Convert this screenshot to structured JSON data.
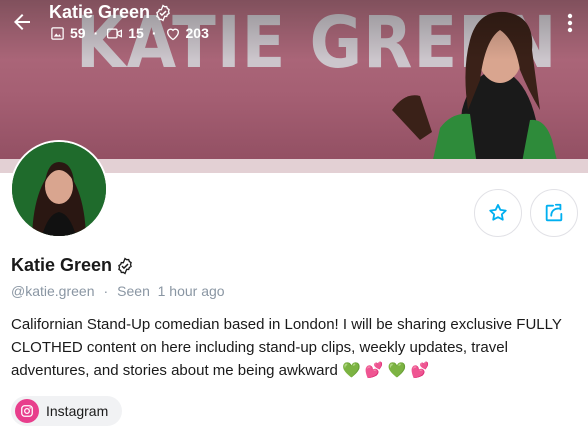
{
  "header": {
    "name": "Katie Green",
    "stats": {
      "photos": "59",
      "videos": "15",
      "likes": "203"
    },
    "banner_text": "KATIE GREEN"
  },
  "profile": {
    "name": "Katie Green",
    "handle": "@katie.green",
    "seen": "Seen  1 hour ago",
    "bio": "Californian Stand-Up comedian based in London! I will be sharing exclusive FULLY CLOTHED content on here including stand-up clips, weekly updates, travel adventures, and stories about me being awkward 💚 💕 💚 💕",
    "social": {
      "instagram_label": "Instagram"
    }
  },
  "icons": {
    "back": "arrow-left-icon",
    "verified": "verified-badge-icon",
    "photos": "image-icon",
    "videos": "video-icon",
    "likes": "heart-icon",
    "more": "more-vertical-icon",
    "favorite": "star-icon",
    "share": "share-icon",
    "instagram": "instagram-icon"
  },
  "colors": {
    "accent": "#00aff0",
    "muted_text": "#8a96a3",
    "instagram": "#e83e8c",
    "banner": "#a55f73"
  }
}
